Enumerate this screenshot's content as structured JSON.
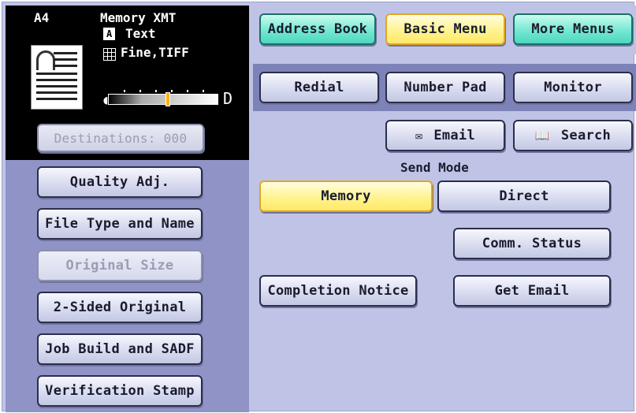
{
  "status": {
    "paper_size": "A4",
    "mode": "Memory XMT",
    "original_type": "Text",
    "resolution": "Fine,TIFF",
    "original_icon": "A",
    "density_level": 0.54,
    "density_left_icon": "contrast-light-icon",
    "density_right_icon": "contrast-dark-icon"
  },
  "destinations": {
    "label": "Destinations: 000"
  },
  "left_menu": [
    {
      "label": "Quality Adj.",
      "enabled": true
    },
    {
      "label": "File Type and Name",
      "enabled": true
    },
    {
      "label": "Original Size",
      "enabled": false
    },
    {
      "label": "2-Sided Original",
      "enabled": true
    },
    {
      "label": "Job Build and SADF",
      "enabled": true
    },
    {
      "label": "Verification Stamp",
      "enabled": true
    }
  ],
  "top_tabs": {
    "address_book": "Address Book",
    "basic_menu": "Basic Menu",
    "more_menus": "More Menus"
  },
  "dial_buttons": {
    "redial": "Redial",
    "number_pad": "Number Pad",
    "monitor": "Monitor"
  },
  "email_button": {
    "label": "Email",
    "icon": "envelope-icon"
  },
  "search_button": {
    "label": "Search",
    "icon": "book-icon"
  },
  "send_mode": {
    "label": "Send Mode",
    "memory": "Memory",
    "direct": "Direct",
    "selected": "Memory"
  },
  "comm_status": "Comm. Status",
  "completion_notice": "Completion Notice",
  "get_email": "Get Email",
  "colors": {
    "panel_bg": "#bfc4e6",
    "left_bg": "#8f93c6",
    "band_bg": "#7d82b8",
    "selected_yellow": "#fff28a",
    "tab_teal": "#6fe6d0"
  }
}
